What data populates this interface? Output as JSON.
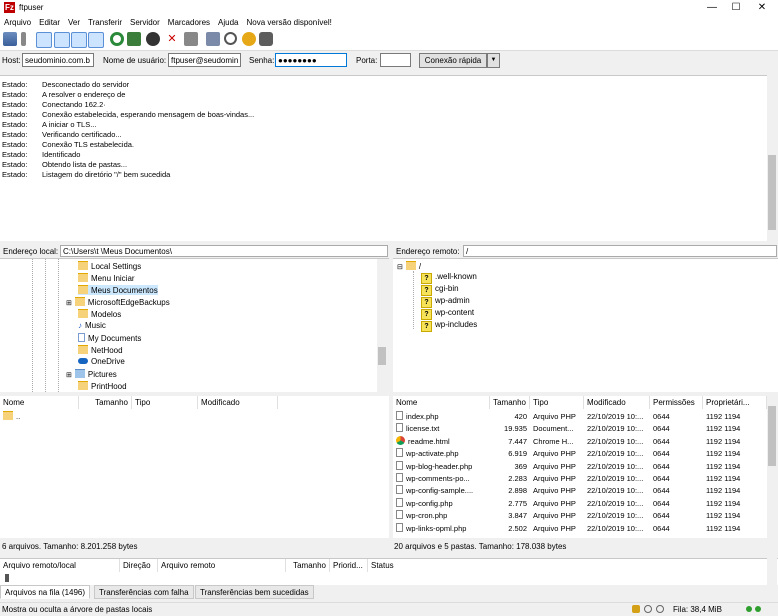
{
  "window": {
    "title": "ftpuser",
    "app_icon": "Fz",
    "minimize": "—",
    "maximize": "☐",
    "close": "✕"
  },
  "menu": [
    "Arquivo",
    "Editar",
    "Ver",
    "Transferir",
    "Servidor",
    "Marcadores",
    "Ajuda",
    "Nova versão disponível!"
  ],
  "quickconnect": {
    "host_label": "Host:",
    "host_value": "seudominio.com.b",
    "user_label": "Nome de usuário:",
    "user_value": "ftpuser@seudomin",
    "pass_label": "Senha:",
    "pass_value": "●●●●●●●●",
    "port_label": "Porta:",
    "port_value": "",
    "connect_button": "Conexão rápida",
    "dropdown_arrow": "▼"
  },
  "log": [
    {
      "k": "Estado:",
      "v": "Desconectado do servidor"
    },
    {
      "k": "Estado:",
      "v": "A resolver o endereço de"
    },
    {
      "k": "Estado:",
      "v": "Conectando 162.2·"
    },
    {
      "k": "Estado:",
      "v": "Conexão estabelecida, esperando mensagem de boas-vindas..."
    },
    {
      "k": "Estado:",
      "v": "A iniciar o TLS..."
    },
    {
      "k": "Estado:",
      "v": "Verificando certificado..."
    },
    {
      "k": "Estado:",
      "v": "Conexão TLS estabelecida."
    },
    {
      "k": "Estado:",
      "v": "Identificado"
    },
    {
      "k": "Estado:",
      "v": "Obtendo lista de pastas..."
    },
    {
      "k": "Estado:",
      "v": "Listagem do diretório \"/\" bem sucedida"
    }
  ],
  "local": {
    "addr_label": "Endereço local:",
    "addr_value": "C:\\Users\\t            \\Meus Documentos\\",
    "tree": [
      "Local Settings",
      "Menu Iniciar",
      "Meus Documentos",
      "MicrosoftEdgeBackups",
      "Modelos",
      "Music",
      "My Documents",
      "NetHood",
      "OneDrive",
      "Pictures",
      "PrintHood"
    ],
    "headers": [
      "Nome",
      "Tamanho",
      "Tipo",
      "Modificado"
    ],
    "files": [
      ".."
    ],
    "status": "6 arquivos. Tamanho: 8.201.258 bytes"
  },
  "remote": {
    "addr_label": "Endereço remoto:",
    "addr_value": "/",
    "tree_root": "/",
    "tree": [
      ".well-known",
      "cgi-bin",
      "wp-admin",
      "wp-content",
      "wp-includes"
    ],
    "headers": [
      "Nome",
      "Tamanho",
      "Tipo",
      "Modificado",
      "Permissões",
      "Proprietári..."
    ],
    "files": [
      {
        "name": "index.php",
        "size": "420",
        "type": "Arquivo PHP",
        "mod": "22/10/2019 10:...",
        "perm": "0644",
        "owner": "1192 1194"
      },
      {
        "name": "license.txt",
        "size": "19.935",
        "type": "Document...",
        "mod": "22/10/2019 10:...",
        "perm": "0644",
        "owner": "1192 1194"
      },
      {
        "name": "readme.html",
        "size": "7.447",
        "type": "Chrome H...",
        "mod": "22/10/2019 10:...",
        "perm": "0644",
        "owner": "1192 1194"
      },
      {
        "name": "wp-activate.php",
        "size": "6.919",
        "type": "Arquivo PHP",
        "mod": "22/10/2019 10:...",
        "perm": "0644",
        "owner": "1192 1194"
      },
      {
        "name": "wp-blog-header.php",
        "size": "369",
        "type": "Arquivo PHP",
        "mod": "22/10/2019 10:...",
        "perm": "0644",
        "owner": "1192 1194"
      },
      {
        "name": "wp-comments-po...",
        "size": "2.283",
        "type": "Arquivo PHP",
        "mod": "22/10/2019 10:...",
        "perm": "0644",
        "owner": "1192 1194"
      },
      {
        "name": "wp-config-sample....",
        "size": "2.898",
        "type": "Arquivo PHP",
        "mod": "22/10/2019 10:...",
        "perm": "0644",
        "owner": "1192 1194"
      },
      {
        "name": "wp-config.php",
        "size": "2.775",
        "type": "Arquivo PHP",
        "mod": "22/10/2019 10:...",
        "perm": "0644",
        "owner": "1192 1194"
      },
      {
        "name": "wp-cron.php",
        "size": "3.847",
        "type": "Arquivo PHP",
        "mod": "22/10/2019 10:...",
        "perm": "0644",
        "owner": "1192 1194"
      },
      {
        "name": "wp-links-opml.php",
        "size": "2.502",
        "type": "Arquivo PHP",
        "mod": "22/10/2019 10:...",
        "perm": "0644",
        "owner": "1192 1194"
      }
    ],
    "status": "20 arquivos e 5 pastas. Tamanho: 178.038 bytes"
  },
  "queue": {
    "headers": [
      "Arquivo remoto/local",
      "Direção",
      "Arquivo remoto",
      "Tamanho",
      "Priorid...",
      "Status"
    ]
  },
  "tabs": [
    "Arquivos na fila (1496)",
    "Transferências com falha",
    "Transferências bem sucedidas"
  ],
  "statusbar": {
    "left": "Mostra ou oculta a árvore de pastas locais",
    "queue": "Fila: 38,4 MiB"
  }
}
